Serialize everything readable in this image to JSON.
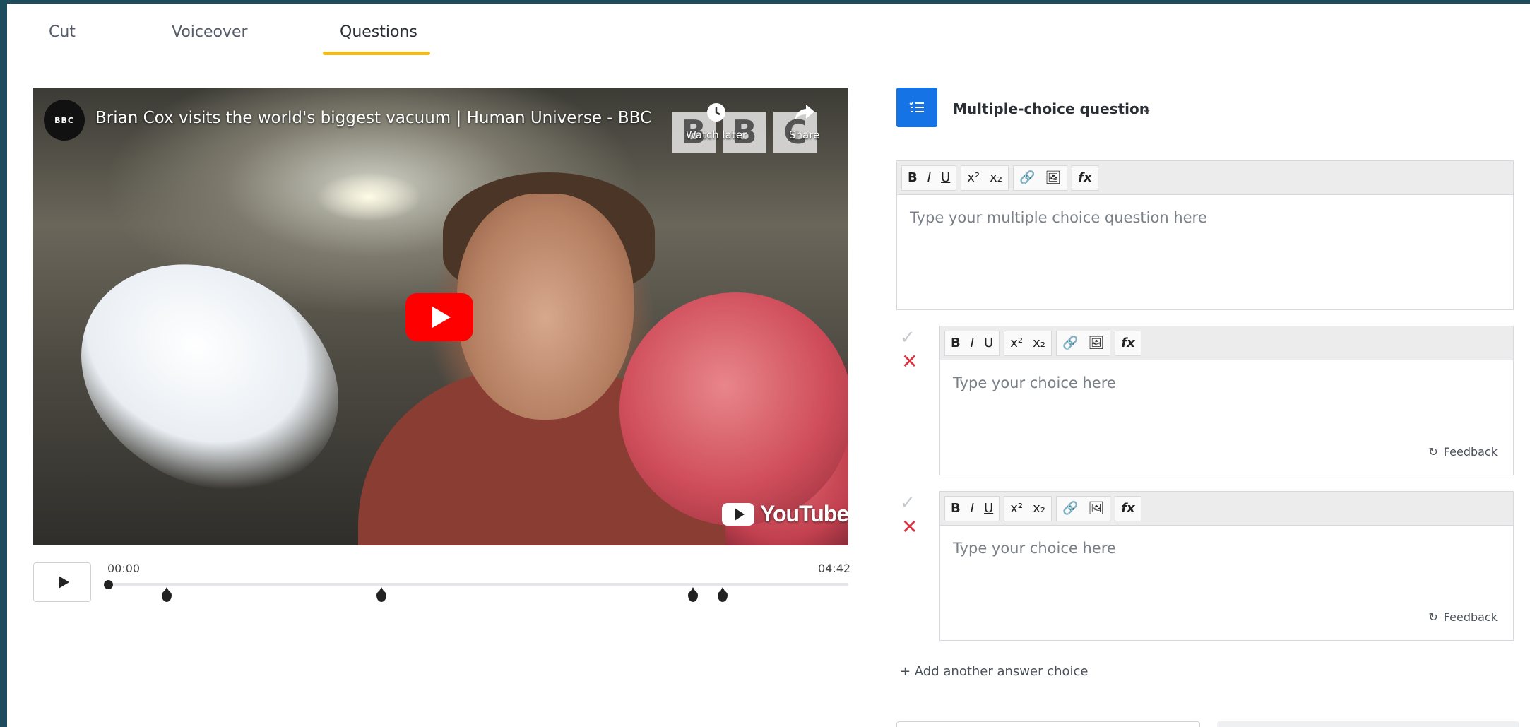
{
  "tabs": [
    {
      "label": "Cut"
    },
    {
      "label": "Voiceover"
    },
    {
      "label": "Questions"
    }
  ],
  "video": {
    "title": "Brian Cox visits the world's biggest vacuum | Human Universe - BBC",
    "channel_avatar": "BBC",
    "watch_later_label": "Watch later",
    "share_label": "Share",
    "youtube_logo": "YouTube"
  },
  "player": {
    "time_current": "00:00",
    "time_total": "04:42",
    "question_markers": [
      0.08,
      0.37,
      0.79,
      0.83
    ]
  },
  "question": {
    "type_label": "Multiple-choice question",
    "toolbar": {
      "bold": "B",
      "italic": "I",
      "underline": "U",
      "superscript": "x²",
      "subscript": "x₂",
      "formula": "fx"
    },
    "placeholder": "Type your multiple choice question here",
    "choices": [
      {
        "placeholder": "Type your choice here",
        "feedback_label": "Feedback"
      },
      {
        "placeholder": "Type your choice here",
        "feedback_label": "Feedback"
      }
    ],
    "add_choice_label": "+ Add another answer choice"
  },
  "colors": {
    "accent_tab": "#f2bb1c",
    "question_type_icon": "#1673e6",
    "incorrect_mark": "#d93341",
    "youtube_red": "#ff0000"
  }
}
